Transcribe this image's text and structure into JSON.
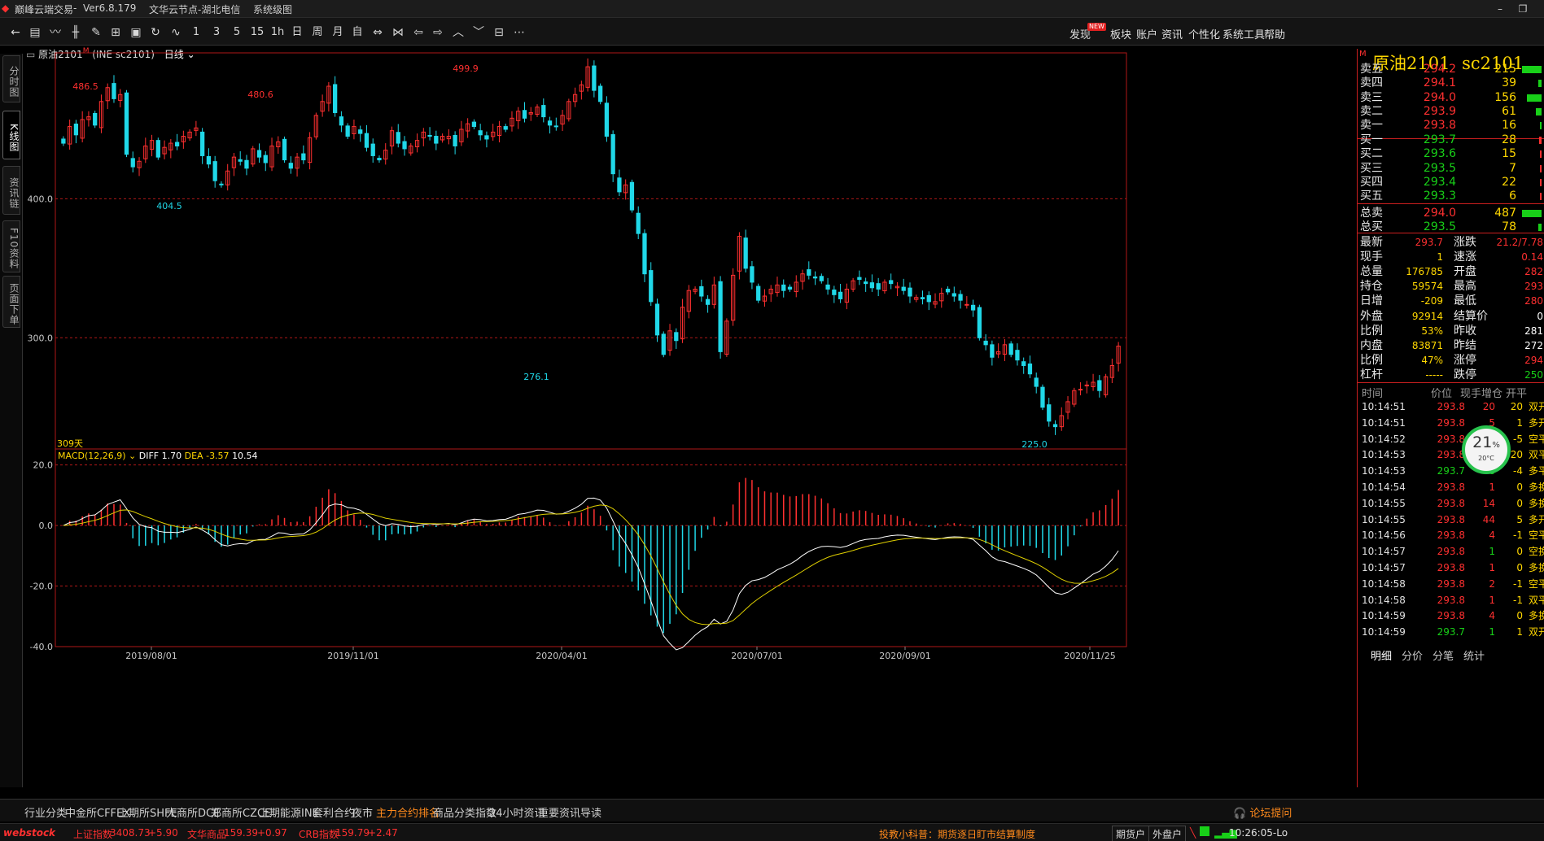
{
  "app": {
    "title": "巅峰云端交易",
    "version": "Ver6.8.179",
    "server": "文华云节点-湖北电信",
    "system_menu": "系统级图"
  },
  "toolbar": {
    "periods": [
      "1",
      "3",
      "5",
      "15",
      "1h",
      "日",
      "周",
      "月",
      "自"
    ],
    "menus": [
      "发现",
      "板块",
      "账户",
      "资讯",
      "个性化",
      "系统工具",
      "帮助"
    ],
    "new_badge": "NEW",
    "icons": [
      "back-icon",
      "list-icon",
      "line-chart-icon",
      "candlestick-icon",
      "draw-icon",
      "table-icon",
      "save-icon",
      "refresh-icon",
      "indicator-icon",
      "swap-icon",
      "bracket-icon",
      "left-arrow-icon",
      "right-arrow-icon",
      "up-icon",
      "down-icon",
      "layout-icon",
      "more-icon"
    ]
  },
  "left_tabs": [
    "分时图",
    "K线图",
    "资讯链",
    "F10资料",
    "页面下单"
  ],
  "chart_header": {
    "product": "原油2101",
    "marker": "M",
    "code": "(INE sc2101)",
    "period": "日线"
  },
  "chart_data": {
    "type": "candlestick",
    "ylim": [
      220,
      505
    ],
    "yticks": [
      "400.0",
      "300.0"
    ],
    "price_labels": [
      "486.5",
      "480.6",
      "499.9",
      "404.5",
      "276.1",
      "225.0"
    ],
    "xlabels": [
      "2019/08/01",
      "2019/11/01",
      "2020/04/01",
      "2020/07/01",
      "2020/09/01",
      "2020/11/25"
    ],
    "days_label": "309天",
    "macd": {
      "label": "MACD(12,26,9)",
      "diff_label": "DIFF",
      "diff": "1.70",
      "dea_label": "DEA",
      "dea": "-3.57",
      "macd_value": "10.54",
      "ylim": [
        -40,
        20
      ],
      "yticks": [
        "20.0",
        "0.0",
        "-20.0",
        "-40.0"
      ]
    },
    "series": [
      {
        "seg": "2019",
        "values": [
          440,
          452,
          446,
          457,
          459,
          453,
          470,
          480,
          472,
          475,
          432,
          423,
          427,
          438,
          442,
          430,
          437,
          440,
          438,
          445,
          448,
          451,
          431,
          425,
          413,
          410,
          420,
          430,
          427,
          422,
          436,
          430,
          426,
          438,
          441,
          428,
          422,
          430,
          428,
          444,
          460,
          470,
          481,
          462,
          453,
          445,
          452,
          447,
          437,
          431,
          428,
          435,
          449,
          440,
          436,
          438,
          442,
          448,
          445,
          440,
          445,
          445,
          438,
          450,
          454,
          452,
          446,
          443,
          448,
          452,
          450,
          458,
          463,
          458,
          462,
          466,
          459,
          453,
          452,
          460,
          470,
          475,
          482,
          495,
          478,
          470
        ]
      },
      {
        "seg": "2020a",
        "values": [
          445,
          418,
          405,
          410,
          392,
          375,
          346,
          326,
          302,
          288,
          305,
          298,
          322,
          334,
          335,
          330,
          324,
          338,
          290,
          312,
          345,
          373,
          350,
          340,
          327,
          330,
          335,
          338,
          334,
          335,
          340,
          346,
          345,
          343,
          341,
          335,
          331,
          328,
          335,
          341,
          342,
          339,
          336,
          335,
          340,
          339,
          337,
          334,
          330,
          329,
          328,
          326,
          326,
          332,
          333,
          330,
          327,
          324,
          320,
          300,
          295,
          286,
          290,
          295,
          288,
          284,
          280,
          274,
          265,
          250,
          240,
          236,
          244,
          254,
          262,
          263,
          266,
          268,
          262,
          272,
          280,
          294
        ]
      }
    ]
  },
  "quote": {
    "title_name": "原油2101",
    "title_code": "sc2101",
    "marker": "M",
    "asks": [
      {
        "label": "卖五",
        "price": "294.2",
        "vol": "215",
        "size": 1.0
      },
      {
        "label": "卖四",
        "price": "294.1",
        "vol": "39",
        "size": 0.18
      },
      {
        "label": "卖三",
        "price": "294.0",
        "vol": "156",
        "size": 0.73
      },
      {
        "label": "卖二",
        "price": "293.9",
        "vol": "61",
        "size": 0.28
      },
      {
        "label": "卖一",
        "price": "293.8",
        "vol": "16",
        "size": 0.07
      }
    ],
    "bids": [
      {
        "label": "买一",
        "price": "293.7",
        "vol": "28",
        "size": 0.13
      },
      {
        "label": "买二",
        "price": "293.6",
        "vol": "15",
        "size": 0.07
      },
      {
        "label": "买三",
        "price": "293.5",
        "vol": "7",
        "size": 0.03
      },
      {
        "label": "买四",
        "price": "293.4",
        "vol": "22",
        "size": 0.1
      },
      {
        "label": "买五",
        "price": "293.3",
        "vol": "6",
        "size": 0.03
      }
    ],
    "totals": [
      {
        "label": "总卖",
        "price": "294.0",
        "vol": "487",
        "size": 1.0
      },
      {
        "label": "总买",
        "price": "293.5",
        "vol": "78",
        "size": 0.16
      }
    ],
    "stats_left": [
      {
        "label": "最新",
        "value": "293.7",
        "color": "#ff3030"
      },
      {
        "label": "现手",
        "value": "1",
        "color": "#ffd700"
      },
      {
        "label": "总量",
        "value": "176785",
        "color": "#ffd700"
      },
      {
        "label": "持仓",
        "value": "59574",
        "color": "#ffd700"
      },
      {
        "label": "日增",
        "value": "-209",
        "color": "#ffd700"
      },
      {
        "label": "外盘",
        "value": "92914",
        "color": "#ffd700"
      },
      {
        "label": "比例",
        "value": "53%",
        "color": "#ffd700"
      },
      {
        "label": "内盘",
        "value": "83871",
        "color": "#ffd700"
      },
      {
        "label": "比例",
        "value": "47%",
        "color": "#ffd700"
      },
      {
        "label": "杠杆",
        "value": "-----",
        "color": "#ffd700"
      }
    ],
    "stats_right": [
      {
        "label": "涨跌",
        "value": "21.2/7.78",
        "color": "#ff3030"
      },
      {
        "label": "速涨",
        "value": "0.14",
        "color": "#ff3030"
      },
      {
        "label": "开盘",
        "value": "282",
        "color": "#ff3030"
      },
      {
        "label": "最高",
        "value": "293",
        "color": "#ff3030"
      },
      {
        "label": "最低",
        "value": "280",
        "color": "#ff3030"
      },
      {
        "label": "结算价",
        "value": "0",
        "color": "#ffffff"
      },
      {
        "label": "昨收",
        "value": "281",
        "color": "#ffffff"
      },
      {
        "label": "昨结",
        "value": "272",
        "color": "#ffffff"
      },
      {
        "label": "涨停",
        "value": "294",
        "color": "#ff3030"
      },
      {
        "label": "跌停",
        "value": "250",
        "color": "#18d018"
      }
    ],
    "ticks_header": [
      "时间",
      "价位",
      "现手",
      "增仓",
      "开平"
    ],
    "ticks": [
      {
        "time": "10:14:51",
        "price": "293.8",
        "vol": "20",
        "oi": "20",
        "type": "双开",
        "vc": "#ff3030",
        "tc": "#ffd700"
      },
      {
        "time": "10:14:51",
        "price": "293.8",
        "vol": "5",
        "oi": "1",
        "type": "多开",
        "vc": "#ff3030",
        "tc": "#ffd700"
      },
      {
        "time": "10:14:52",
        "price": "293.8",
        "vol": "7",
        "oi": "-5",
        "type": "空平",
        "vc": "#ff3030",
        "tc": "#ffd700"
      },
      {
        "time": "10:14:53",
        "price": "293.8",
        "vol": "27",
        "oi": "-20",
        "type": "双平",
        "vc": "#18d018",
        "tc": "#ffd700"
      },
      {
        "time": "10:14:53",
        "price": "293.7",
        "vol": "8",
        "oi": "-4",
        "type": "多平",
        "vc": "#18d018",
        "tc": "#ffd700"
      },
      {
        "time": "10:14:54",
        "price": "293.8",
        "vol": "1",
        "oi": "0",
        "type": "多换",
        "vc": "#ff3030",
        "tc": "#ffd700"
      },
      {
        "time": "10:14:55",
        "price": "293.8",
        "vol": "14",
        "oi": "0",
        "type": "多换",
        "vc": "#ff3030",
        "tc": "#ffd700"
      },
      {
        "time": "10:14:55",
        "price": "293.8",
        "vol": "44",
        "oi": "5",
        "type": "多开",
        "vc": "#ff3030",
        "tc": "#ffd700"
      },
      {
        "time": "10:14:56",
        "price": "293.8",
        "vol": "4",
        "oi": "-1",
        "type": "空平",
        "vc": "#ff3030",
        "tc": "#ffd700"
      },
      {
        "time": "10:14:57",
        "price": "293.8",
        "vol": "1",
        "oi": "0",
        "type": "空换",
        "vc": "#18d018",
        "tc": "#ffd700"
      },
      {
        "time": "10:14:57",
        "price": "293.8",
        "vol": "1",
        "oi": "0",
        "type": "多换",
        "vc": "#ff3030",
        "tc": "#ffd700"
      },
      {
        "time": "10:14:58",
        "price": "293.8",
        "vol": "2",
        "oi": "-1",
        "type": "空平",
        "vc": "#ff3030",
        "tc": "#ffd700"
      },
      {
        "time": "10:14:58",
        "price": "293.8",
        "vol": "1",
        "oi": "-1",
        "type": "双平",
        "vc": "#ff3030",
        "tc": "#ffd700"
      },
      {
        "time": "10:14:59",
        "price": "293.8",
        "vol": "4",
        "oi": "0",
        "type": "多换",
        "vc": "#ff3030",
        "tc": "#ffd700"
      },
      {
        "time": "10:14:59",
        "price": "293.7",
        "vol": "1",
        "oi": "1",
        "type": "双开",
        "vc": "#18d018",
        "tc": "#ffd700"
      }
    ],
    "bottom_tabs": [
      "明细",
      "分价",
      "分笔",
      "统计"
    ],
    "badge_percent": "21",
    "badge_unit": "%",
    "badge_temp": "20°C"
  },
  "bottom_tabs": [
    "行业分类",
    "中金所CFFEX",
    "上期所SHFE",
    "大商所DCE",
    "郑商所CZCE",
    "上期能源INE",
    "套利合约",
    "夜市",
    "主力合约排名",
    "商品分类指数",
    "24小时资讯",
    "重要资讯导读"
  ],
  "bottom_active": "主力合约排名",
  "forum_label": "论坛提问",
  "status": {
    "brand": "webstock",
    "idx1_name": "上证指数",
    "idx1_val": "3408.73",
    "idx1_chg": "+5.90",
    "idx2_name": "文华商品",
    "idx2_val": "159.39",
    "idx2_chg": "+0.97",
    "idx3_name": "CRB指数",
    "idx3_val": "159.79",
    "idx3_chg": "+2.47",
    "notice": "投教小科普：期货逐日盯市结算制度",
    "btn1": "期货户",
    "btn2": "外盘户",
    "time": "10:26:05-Lo"
  },
  "colors": {
    "up": "#ff3030",
    "down": "#20d8e8",
    "accent": "#ff8a1c",
    "gold": "#ffd700",
    "grid": "#b01818"
  }
}
